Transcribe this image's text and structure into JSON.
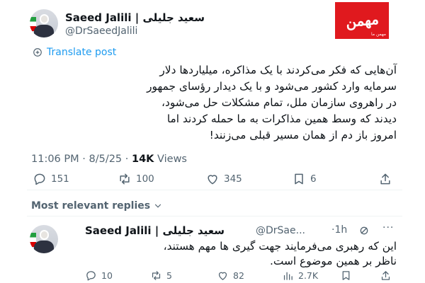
{
  "brand": {
    "logo_text": "مهمن",
    "logo_sub": "مهمن ما",
    "color": "#e0191e"
  },
  "tweet": {
    "author_name": "Saeed Jalili | سعید جلیلی",
    "author_handle": "@DrSaeedJalili",
    "translate_label": "Translate post",
    "lines": [
      "آن‌هایی که فکر می‌کردند با یک مذاکره، میلیاردها دلار",
      "سرمایه وارد کشور می‌شود و با یک دیدار رؤسای جمهور",
      "در راهروی سازمان ملل، تمام مشکلات حل می‌شود،",
      "دیدند که وسط همین مذاکرات به ما حمله کردند اما",
      "امروز باز دم از همان مسیر قبلی می‌زنند!"
    ],
    "time": "11:06 PM",
    "date": "8/5/25",
    "separator": "·",
    "views": "14K",
    "views_label": "Views",
    "replies": "151",
    "reposts": "100",
    "likes": "345",
    "bookmarks": "6"
  },
  "replies_header": {
    "sort_label": "Most relevant replies"
  },
  "reply": {
    "author_name": "Saeed Jalili | سعید جلیلی",
    "author_handle": "@DrSae...",
    "time": "·1h",
    "lines": [
      "این که رهبری می‌فرمایند جهت گیری ها مهم هستند،",
      "ناظر بر همین موضوع است."
    ],
    "replies": "10",
    "reposts": "5",
    "likes": "82",
    "views": "2.7K"
  },
  "icons": {
    "reply": "reply-icon",
    "repost": "repost-icon",
    "like": "heart-icon",
    "bookmark": "bookmark-icon",
    "share": "share-icon",
    "views": "views-chart-icon",
    "translate": "translate-icon",
    "chevron": "chevron-down-icon",
    "more": "more-icon"
  },
  "colors": {
    "accent": "#1d9bf0",
    "muted": "#536471",
    "text": "#0f1419"
  }
}
